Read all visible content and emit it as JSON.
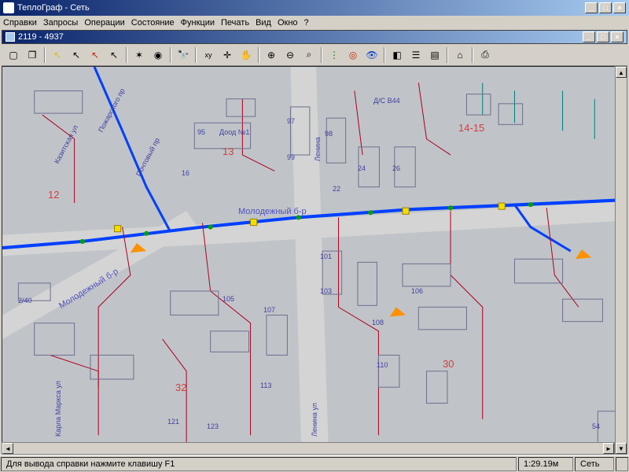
{
  "app": {
    "title": "ТеплоГраф - Сеть",
    "doc_title": "2119 - 4937"
  },
  "window_controls": {
    "min": "_",
    "max": "□",
    "close": "×"
  },
  "doc_controls": {
    "min": "_",
    "max": "□",
    "close": "×"
  },
  "menu": {
    "items": [
      "Справки",
      "Запросы",
      "Операции",
      "Состояние",
      "Функции",
      "Печать",
      "Вид",
      "Окно",
      "?"
    ]
  },
  "toolbar": {
    "names": [
      "new-doc-icon",
      "copy-icon",
      "sep",
      "arrow-yellow-icon",
      "arrow-black-icon",
      "arrow-red-icon",
      "arrow-add-icon",
      "sep",
      "network-icon",
      "node-edit-icon",
      "sep",
      "binoculars-icon",
      "sep",
      "xy-icon",
      "crosshair-icon",
      "pan-hand-icon",
      "sep",
      "zoom-in-icon",
      "zoom-out-icon",
      "zoom-region-icon",
      "sep",
      "traffic-light-icon",
      "target-icon",
      "eye-icon",
      "sep",
      "shapes-icon",
      "grouping-icon",
      "stack-icon",
      "sep",
      "house-icon",
      "sep",
      "print-icon"
    ]
  },
  "map": {
    "main_street": "Молодежный б-р",
    "zones": {
      "z12": "12",
      "z13": "13",
      "z14_15": "14-15",
      "z30": "30",
      "z32": "32"
    },
    "streets": {
      "karla_marksa": "Карла Маркса ул",
      "lenina": "Ленина",
      "lenina_ul": "Ленина ул",
      "molodezhny_left": "Молодежный б-р",
      "pozharskogo": "Пожарского пр",
      "kaditskaya": "Казитская ул",
      "pochtovyy": "Почтовый пр"
    },
    "bldg": {
      "b95": "95",
      "b97": "97",
      "b98": "98",
      "b99": "99",
      "b16": "16",
      "b22": "22",
      "b24": "24",
      "b26": "26",
      "b101": "101",
      "b103": "103",
      "b105": "105",
      "b106": "106",
      "b107": "107",
      "b108": "108",
      "b110": "110",
      "b113": "113",
      "b121": "121",
      "b123": "123",
      "b2_40": "2/40",
      "b54": "54",
      "dsad": "Доод №1",
      "dc": "Д/С В44"
    }
  },
  "status": {
    "help": "Для вывода справки нажмите клавишу F1",
    "coord": "1:29.19м",
    "net": "Сеть"
  },
  "colors": {
    "titlebar_start": "#0a246a",
    "titlebar_end": "#a6caf0",
    "bg": "#d4d0c8",
    "map_bg": "#c8c8c8",
    "pipe_main": "#0040ff",
    "pipe_branch_red": "#e00000",
    "pipe_branch_teal": "#008080",
    "building_outline": "#606090",
    "node_green": "#008000",
    "node_yellow": "#f0e000",
    "arrow_orange": "#ff9000",
    "label_red": "#d04040"
  }
}
